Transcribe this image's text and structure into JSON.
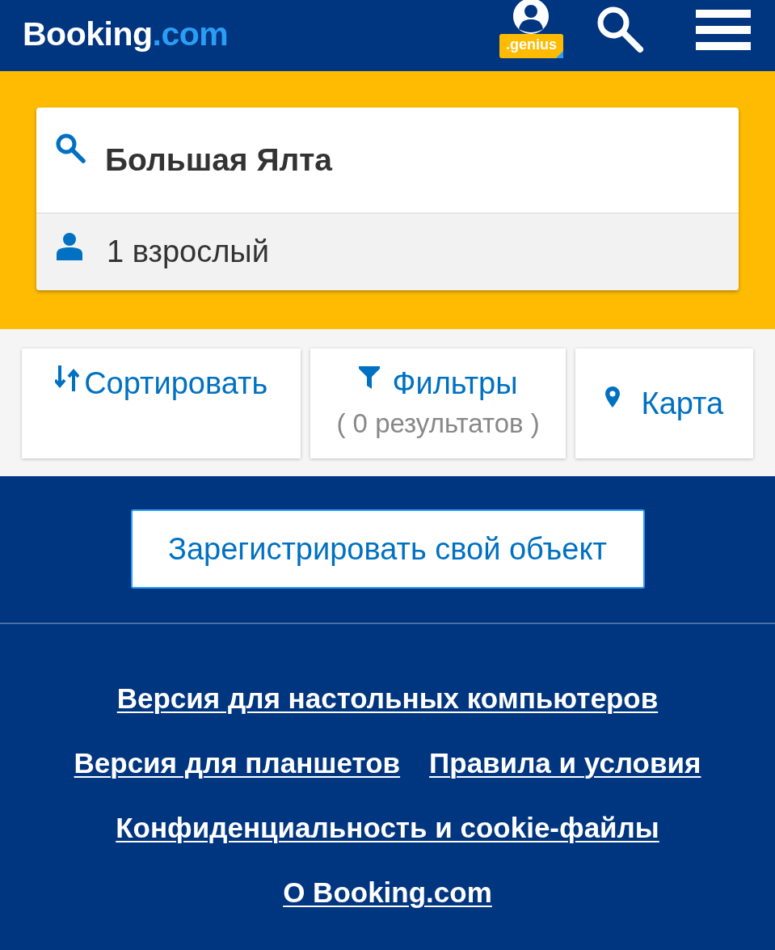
{
  "header": {
    "logo": {
      "name": "Booking",
      "suffix": ".com"
    },
    "genius_badge": ".genius"
  },
  "search": {
    "destination": "Большая Ялта",
    "guests": "1 взрослый"
  },
  "actions": [
    {
      "kind": "sort",
      "label": "Сортировать"
    },
    {
      "kind": "filter",
      "label": "Фильтры",
      "note": "( 0 результатов )"
    },
    {
      "kind": "map",
      "label": "Карта"
    }
  ],
  "register_button": "Зарегистрировать свой объект",
  "footer_rows": [
    {
      "links": [
        "Версия для настольных компьютеров"
      ]
    },
    {
      "links": [
        "Версия для планшетов",
        "Правила и условия"
      ]
    },
    {
      "links": [
        "Конфиденциальность и cookie-файлы"
      ]
    },
    {
      "links": [
        "О Booking.com"
      ]
    }
  ]
}
